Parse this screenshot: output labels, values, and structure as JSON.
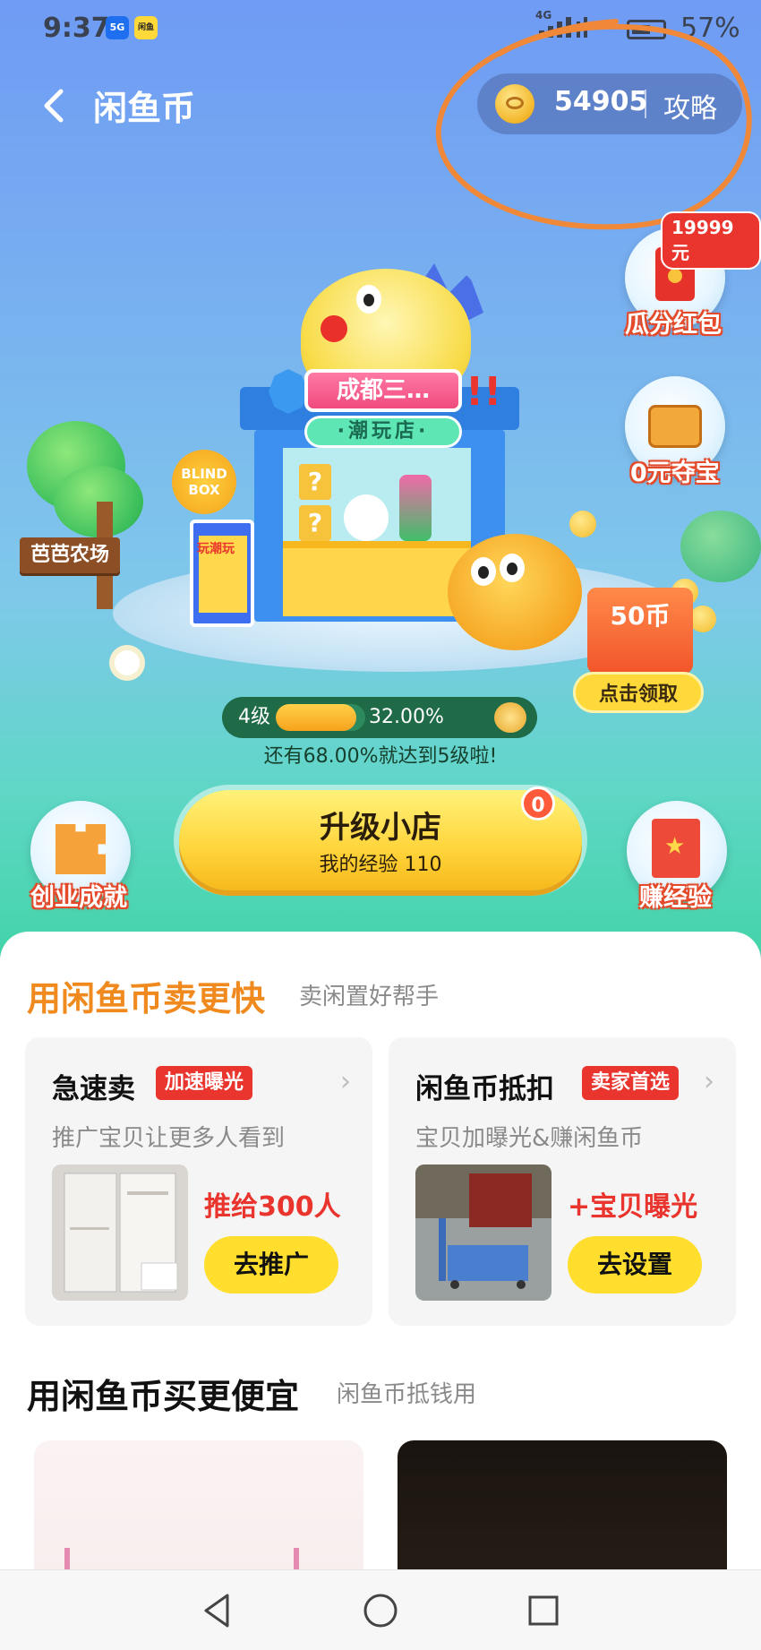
{
  "status_bar": {
    "time": "9:37",
    "app_icon_1": "5G",
    "app_icon_2": "闲鱼",
    "network": "4G",
    "battery": "57%"
  },
  "header": {
    "back_icon": "chevron-left-icon",
    "title": "闲鱼币",
    "coin_balance": "54905",
    "guide_label": "攻略"
  },
  "side_badges": {
    "red_packet": {
      "label": "瓜分红包",
      "prize": "19999元",
      "icon": "red-packet-icon"
    },
    "treasure": {
      "label": "0元夺宝",
      "icon": "treasure-chest-icon"
    },
    "achievement": {
      "label": "创业成就",
      "icon": "puzzle-icon"
    },
    "earn_exp": {
      "label": "赚经验",
      "icon": "book-icon"
    }
  },
  "shop_scene": {
    "shop_name": "成都三…",
    "shop_type": "·潮玩店·",
    "blind_box": "BLIND BOX",
    "poster_text": "玩潮玩",
    "farm_sign": "芭芭农场",
    "coin_box_value": "50币",
    "claim_button": "点击领取"
  },
  "progress": {
    "level": "4级",
    "percent_text": "32.00%",
    "percent_value": 32,
    "hint": "还有68.00%就达到5级啦!"
  },
  "upgrade": {
    "label": "升级小店",
    "sub_label": "我的经验 110",
    "badge_count": "0"
  },
  "sell_section": {
    "title": "用闲鱼币卖更快",
    "subtitle": "卖闲置好帮手",
    "cards": [
      {
        "title": "急速卖",
        "tag": "加速曝光",
        "desc": "推广宝贝让更多人看到",
        "promo": "推给300人",
        "button": "去推广"
      },
      {
        "title": "闲鱼币抵扣",
        "tag": "卖家首选",
        "desc": "宝贝加曝光&赚闲鱼币",
        "promo": "+宝贝曝光",
        "button": "去设置"
      }
    ]
  },
  "buy_section": {
    "title": "用闲鱼币买更便宜",
    "subtitle": "闲鱼币抵钱用"
  },
  "colors": {
    "accent_orange": "#f08a1e",
    "tag_red": "#e9352d",
    "button_yellow": "#ffde2e",
    "annotation_orange": "#f0883a"
  }
}
